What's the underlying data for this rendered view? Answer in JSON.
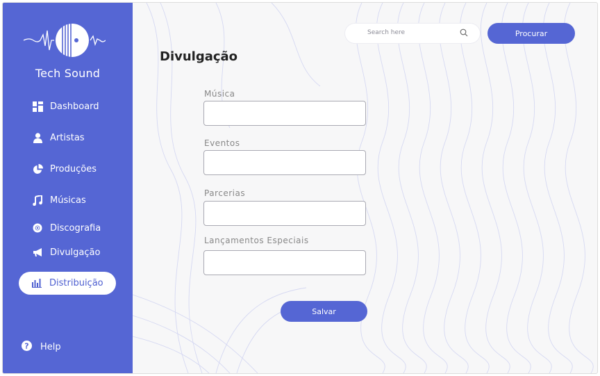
{
  "brand": {
    "name": "Tech Sound"
  },
  "sidebar": {
    "items": [
      {
        "label": "Dashboard",
        "icon": "dashboard-icon"
      },
      {
        "label": "Artistas",
        "icon": "person-icon"
      },
      {
        "label": "Produções",
        "icon": "pie-chart-icon"
      },
      {
        "label": "Músicas",
        "icon": "music-note-icon"
      },
      {
        "label": "Discografia",
        "icon": "disc-icon"
      },
      {
        "label": "Divulgação",
        "icon": "megaphone-icon"
      },
      {
        "label": "Distribuição",
        "icon": "bar-chart-icon",
        "active": true
      }
    ],
    "help": {
      "label": "Help",
      "icon": "help-icon"
    }
  },
  "search": {
    "placeholder": "Search here",
    "button_label": "Procurar"
  },
  "page": {
    "title": "Divulgação"
  },
  "form": {
    "fields": [
      {
        "label": "Música",
        "value": ""
      },
      {
        "label": "Eventos",
        "value": ""
      },
      {
        "label": "Parcerias",
        "value": ""
      },
      {
        "label": "Lançamentos Especiais",
        "value": ""
      }
    ],
    "save_label": "Salvar"
  },
  "colors": {
    "accent": "#5566d4",
    "background": "#f7f7f8",
    "contour": "#d5d8f2"
  }
}
